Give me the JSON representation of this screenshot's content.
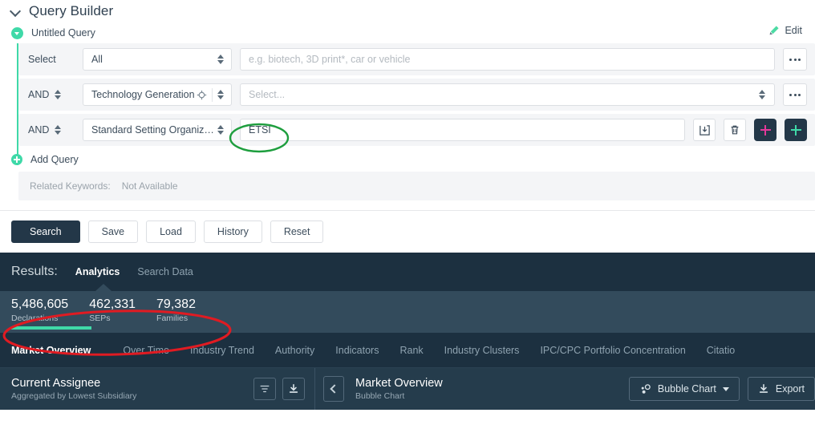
{
  "query_builder": {
    "title": "Query Builder",
    "collapse_icon": "chevron-down-icon",
    "query_name": "Untitled Query",
    "edit_label": "Edit",
    "edit_icon": "pencil-icon",
    "rows": [
      {
        "conjunction": "Select",
        "field": "All",
        "value": "",
        "placeholder": "e.g. biotech, 3D print*, car or vehicle",
        "more_label": "•••"
      },
      {
        "conjunction": "AND",
        "field": "Technology Generation",
        "value": "",
        "placeholder": "Select...",
        "more_label": "•••"
      },
      {
        "conjunction": "AND",
        "field": "Standard Setting Organiza...",
        "value": "ETSI",
        "placeholder": "",
        "more_label": ""
      }
    ],
    "row_icons": {
      "save_query": "save-icon",
      "delete_query": "trash-icon",
      "add_magenta": "plus-icon",
      "add_teal": "plus-icon",
      "crosshair": "target-icon"
    },
    "add_query_label": "Add Query",
    "related_keywords_label": "Related Keywords:",
    "related_keywords_value": "Not Available",
    "actions": [
      {
        "label": "Search",
        "primary": true
      },
      {
        "label": "Save",
        "primary": false
      },
      {
        "label": "Load",
        "primary": false
      },
      {
        "label": "History",
        "primary": false
      },
      {
        "label": "Reset",
        "primary": false
      }
    ]
  },
  "results": {
    "label": "Results:",
    "tabs": [
      {
        "label": "Analytics",
        "active": true
      },
      {
        "label": "Search Data",
        "active": false
      }
    ],
    "stats": [
      {
        "value": "5,486,605",
        "caption": "Declarations",
        "underlined": true
      },
      {
        "value": "462,331",
        "caption": "SEPs",
        "underlined": false
      },
      {
        "value": "79,382",
        "caption": "Families",
        "underlined": false
      }
    ],
    "analytics_tabs": [
      {
        "label": "Market Overview",
        "active": true
      },
      {
        "label": "Over Time",
        "active": false
      },
      {
        "label": "Industry Trend",
        "active": false
      },
      {
        "label": "Authority",
        "active": false
      },
      {
        "label": "Indicators",
        "active": false
      },
      {
        "label": "Rank",
        "active": false
      },
      {
        "label": "Industry Clusters",
        "active": false
      },
      {
        "label": "IPC/CPC Portfolio Concentration",
        "active": false
      },
      {
        "label": "Citatio",
        "active": false
      }
    ]
  },
  "bottom_bar": {
    "left": {
      "title": "Current Assignee",
      "subtitle": "Aggregated by Lowest Subsidiary",
      "filter_icon": "filter-icon",
      "download_icon": "download-icon"
    },
    "right": {
      "back_icon": "chevron-left-icon",
      "title": "Market Overview",
      "subtitle": "Bubble Chart",
      "chart_type_label": "Bubble Chart",
      "chart_type_icon": "bubble-chart-icon",
      "export_label": "Export",
      "export_icon": "download-icon"
    }
  },
  "annotations": {
    "green_ellipse_target": "ETSI",
    "green_color": "#1e9e3e",
    "red_ellipse_target": "stats",
    "red_color": "#e01b22"
  }
}
